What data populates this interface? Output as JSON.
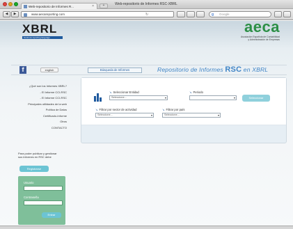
{
  "window": {
    "title": "Web-repositorio de Informes RSC-XBRL",
    "tab_title": "Web-repositorio de Informes R...",
    "tab_close": "×",
    "new_tab": "+"
  },
  "toolbar": {
    "back": "◀",
    "forward": "▶",
    "url": "www.aecareporting.com",
    "reload": "↻",
    "search_engine_label": "g",
    "search_placeholder": "Google",
    "search_icon": "search-icon"
  },
  "header": {
    "xbrl_logo": "XBRL",
    "xbrl_tagline": "business reporting language",
    "aeca_logo": "aeca",
    "aeca_sub_line1": "Asociación Española de Contabilidad",
    "aeca_sub_line2": "y Administración de Empresas"
  },
  "nav": {
    "facebook": "f",
    "language": "english",
    "search_tab": "Búsqueda de Informes",
    "repo_title_prefix": "Repositorio de Informes",
    "repo_title_rsc": "RSC",
    "repo_title_suffix": "en XBRL"
  },
  "sidebar": {
    "items": [
      {
        "label": "¿Qué son los Informes XBRL?"
      },
      {
        "label": "- El Informe CCI-RSC"
      },
      {
        "label": "- El Informe CCI-RSC"
      },
      {
        "label": "Principales utilidades de la web"
      },
      {
        "label": "Política de Datos"
      },
      {
        "label": "Certificado-Informe"
      },
      {
        "label": "Otros"
      },
      {
        "label": "CONTACTO"
      }
    ],
    "publish_note": "Para poder publicar y gestionar sus informes en RSC debe",
    "register_button": "Registrarse"
  },
  "login": {
    "user_label": "Usuario",
    "password_label": "Contraseña",
    "submit": "Entrar"
  },
  "filters": {
    "entity_label": "Seleccionar Entidad",
    "entity_value": "Seleccione...",
    "period_label": "Periodo",
    "period_value": "",
    "sector_label": "Filtrar por sector de actividad",
    "sector_value": "Seleccione...",
    "country_label": "Filtrar por país",
    "country_value": "Seleccione...",
    "select_button": "Seleccionar",
    "caret": "▾"
  },
  "colors": {
    "accent_blue": "#1f5a9e",
    "aeca_green": "#2c8f46",
    "button_teal": "#6cc4d4",
    "login_green": "#7fbf9a"
  }
}
